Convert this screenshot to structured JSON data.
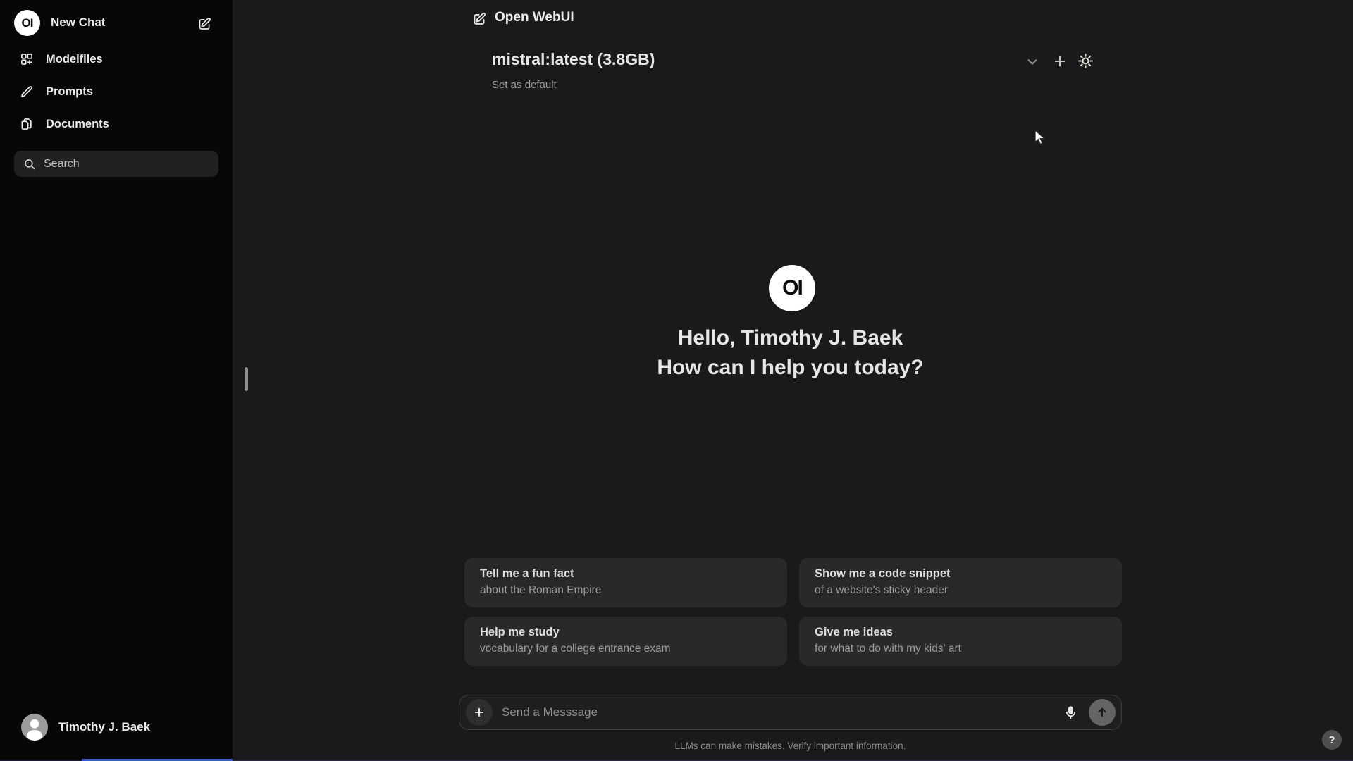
{
  "sidebar": {
    "logo_text": "OI",
    "new_chat_label": "New Chat",
    "items": [
      {
        "label": "Modelfiles",
        "icon": "squares-plus-icon"
      },
      {
        "label": "Prompts",
        "icon": "pencil-icon"
      },
      {
        "label": "Documents",
        "icon": "documents-icon"
      }
    ],
    "search_placeholder": "Search",
    "user_name": "Timothy J. Baek"
  },
  "header": {
    "title": "Open WebUI",
    "new_chat_icon": "pencil-square-icon"
  },
  "model_bar": {
    "model": "mistral:latest (3.8GB)",
    "set_default_label": "Set as default",
    "icons": [
      "chevron-down-icon",
      "plus-icon",
      "gear-icon"
    ]
  },
  "hero": {
    "logo_text": "OI",
    "greeting": "Hello, Timothy J. Baek",
    "question": "How can I help you today?"
  },
  "suggestions": [
    {
      "title": "Tell me a fun fact",
      "subtitle": "about the Roman Empire"
    },
    {
      "title": "Show me a code snippet",
      "subtitle": "of a website's sticky header"
    },
    {
      "title": "Help me study",
      "subtitle": "vocabulary for a college entrance exam"
    },
    {
      "title": "Give me ideas",
      "subtitle": "for what to do with my kids' art"
    }
  ],
  "composer": {
    "placeholder": "Send a Messsage",
    "icons": [
      "plus-icon",
      "microphone-icon",
      "arrow-up-icon"
    ]
  },
  "footer": {
    "disclaimer": "LLMs can make mistakes. Verify important information.",
    "help_label": "?"
  },
  "colors": {
    "sidebar_bg": "#070708",
    "main_bg": "#1a1a1c",
    "card_bg": "#29292b",
    "accent_progress": "#3c5ccc",
    "text_primary": "#ececec",
    "text_secondary": "#9c9c9c"
  }
}
